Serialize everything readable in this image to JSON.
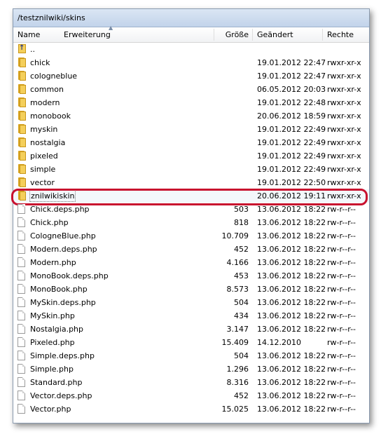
{
  "path": "/testznilwiki/skins",
  "columns": {
    "name": "Name",
    "extension": "Erweiterung",
    "size": "Größe",
    "modified": "Geändert",
    "rights": "Rechte"
  },
  "rows": [
    {
      "icon": "up-folder-icon",
      "name": "..",
      "size": "",
      "date": "",
      "rights": ""
    },
    {
      "icon": "folder-icon",
      "name": "chick",
      "size": "",
      "date": "19.01.2012 22:47",
      "rights": "rwxr-xr-x"
    },
    {
      "icon": "folder-icon",
      "name": "cologneblue",
      "size": "",
      "date": "19.01.2012 22:47",
      "rights": "rwxr-xr-x"
    },
    {
      "icon": "folder-icon",
      "name": "common",
      "size": "",
      "date": "06.05.2012 20:03",
      "rights": "rwxr-xr-x"
    },
    {
      "icon": "folder-icon",
      "name": "modern",
      "size": "",
      "date": "19.01.2012 22:48",
      "rights": "rwxr-xr-x"
    },
    {
      "icon": "folder-icon",
      "name": "monobook",
      "size": "",
      "date": "20.06.2012 18:59",
      "rights": "rwxr-xr-x"
    },
    {
      "icon": "folder-icon",
      "name": "myskin",
      "size": "",
      "date": "19.01.2012 22:49",
      "rights": "rwxr-xr-x"
    },
    {
      "icon": "folder-icon",
      "name": "nostalgia",
      "size": "",
      "date": "19.01.2012 22:49",
      "rights": "rwxr-xr-x"
    },
    {
      "icon": "folder-icon",
      "name": "pixeled",
      "size": "",
      "date": "19.01.2012 22:49",
      "rights": "rwxr-xr-x"
    },
    {
      "icon": "folder-icon",
      "name": "simple",
      "size": "",
      "date": "19.01.2012 22:49",
      "rights": "rwxr-xr-x"
    },
    {
      "icon": "folder-icon",
      "name": "vector",
      "size": "",
      "date": "19.01.2012 22:50",
      "rights": "rwxr-xr-x"
    },
    {
      "icon": "folder-icon",
      "name": "znilwikiskin",
      "size": "",
      "date": "20.06.2012 19:11",
      "rights": "rwxr-xr-x",
      "selected": true
    },
    {
      "icon": "file-icon",
      "name": "Chick.deps.php",
      "size": "503",
      "date": "13.06.2012 18:22",
      "rights": "rw-r--r--"
    },
    {
      "icon": "file-icon",
      "name": "Chick.php",
      "size": "818",
      "date": "13.06.2012 18:22",
      "rights": "rw-r--r--"
    },
    {
      "icon": "file-icon",
      "name": "CologneBlue.php",
      "size": "10.709",
      "date": "13.06.2012 18:22",
      "rights": "rw-r--r--"
    },
    {
      "icon": "file-icon",
      "name": "Modern.deps.php",
      "size": "452",
      "date": "13.06.2012 18:22",
      "rights": "rw-r--r--"
    },
    {
      "icon": "file-icon",
      "name": "Modern.php",
      "size": "4.166",
      "date": "13.06.2012 18:22",
      "rights": "rw-r--r--"
    },
    {
      "icon": "file-icon",
      "name": "MonoBook.deps.php",
      "size": "453",
      "date": "13.06.2012 18:22",
      "rights": "rw-r--r--"
    },
    {
      "icon": "file-icon",
      "name": "MonoBook.php",
      "size": "8.573",
      "date": "13.06.2012 18:22",
      "rights": "rw-r--r--"
    },
    {
      "icon": "file-icon",
      "name": "MySkin.deps.php",
      "size": "504",
      "date": "13.06.2012 18:22",
      "rights": "rw-r--r--"
    },
    {
      "icon": "file-icon",
      "name": "MySkin.php",
      "size": "434",
      "date": "13.06.2012 18:22",
      "rights": "rw-r--r--"
    },
    {
      "icon": "file-icon",
      "name": "Nostalgia.php",
      "size": "3.147",
      "date": "13.06.2012 18:22",
      "rights": "rw-r--r--"
    },
    {
      "icon": "file-icon",
      "name": "Pixeled.php",
      "size": "15.409",
      "date": "14.12.2010",
      "rights": "rw-r--r--"
    },
    {
      "icon": "file-icon",
      "name": "Simple.deps.php",
      "size": "504",
      "date": "13.06.2012 18:22",
      "rights": "rw-r--r--"
    },
    {
      "icon": "file-icon",
      "name": "Simple.php",
      "size": "1.296",
      "date": "13.06.2012 18:22",
      "rights": "rw-r--r--"
    },
    {
      "icon": "file-icon",
      "name": "Standard.php",
      "size": "8.316",
      "date": "13.06.2012 18:22",
      "rights": "rw-r--r--"
    },
    {
      "icon": "file-icon",
      "name": "Vector.deps.php",
      "size": "452",
      "date": "13.06.2012 18:22",
      "rights": "rw-r--r--"
    },
    {
      "icon": "file-icon",
      "name": "Vector.php",
      "size": "15.025",
      "date": "13.06.2012 18:22",
      "rights": "rw-r--r--"
    }
  ],
  "colors": {
    "highlight": "#c8102e",
    "folder": "#f4cf5a",
    "pathbar": "#c2d3ea"
  }
}
